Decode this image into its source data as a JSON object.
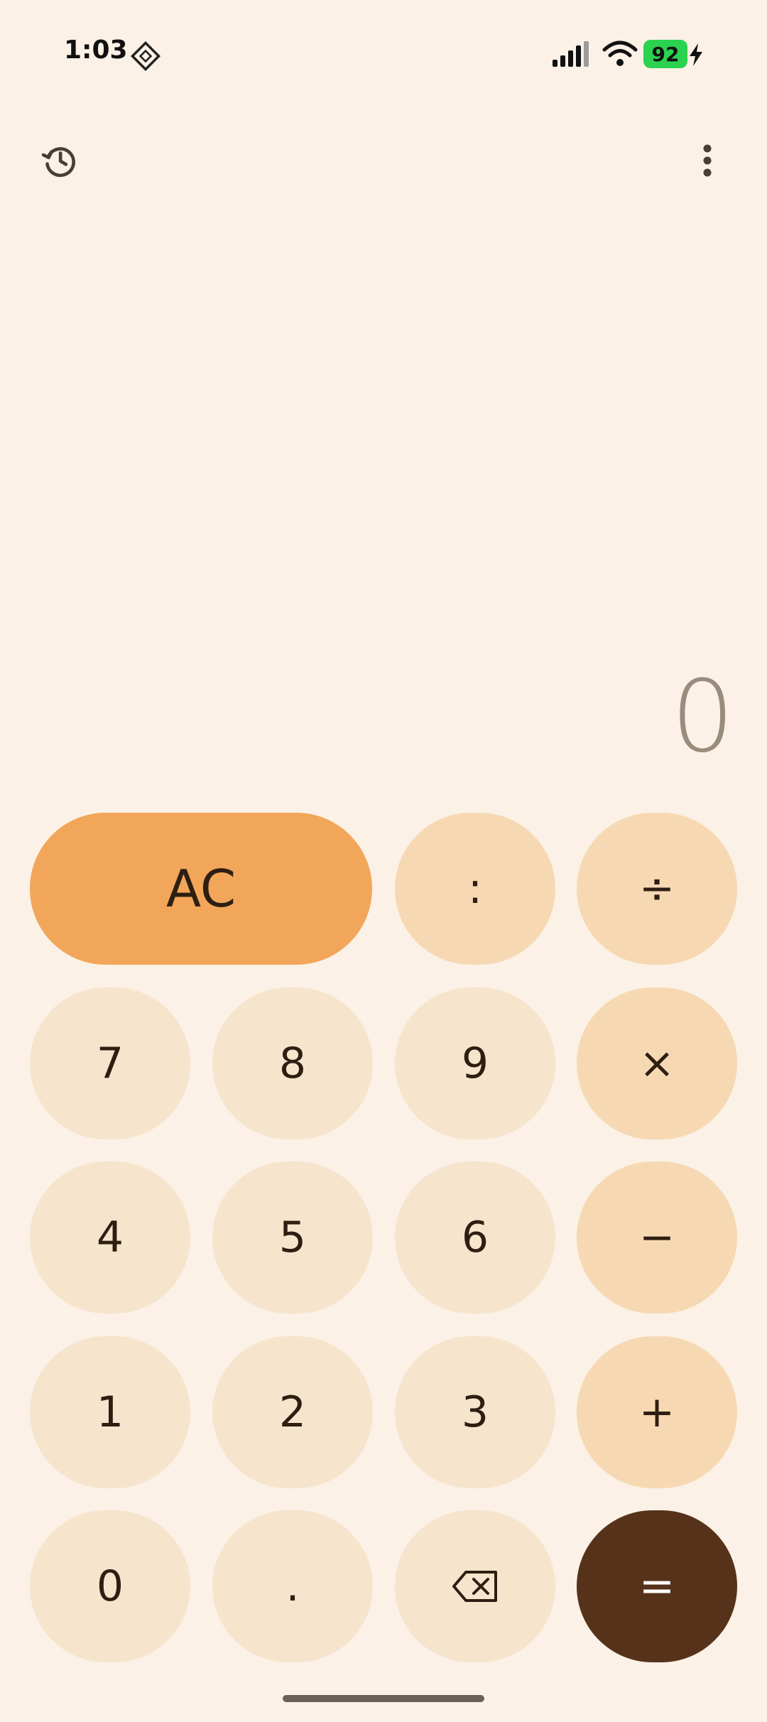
{
  "status_bar": {
    "time": "1:03",
    "battery": "92",
    "icons": [
      "sim-card-icon",
      "signal-icon",
      "wifi-icon",
      "battery-icon",
      "charging-bolt-icon"
    ],
    "battery_color": "#2BD24F"
  },
  "toolbar": {
    "history_icon": "history-icon",
    "more_icon": "more-vert-icon"
  },
  "display": {
    "value": "0"
  },
  "keypad": {
    "clear": "AC",
    "colon": ":",
    "divide": "÷",
    "seven": "7",
    "eight": "8",
    "nine": "9",
    "multiply": "×",
    "four": "4",
    "five": "5",
    "six": "6",
    "minus": "−",
    "one": "1",
    "two": "2",
    "three": "3",
    "plus": "+",
    "zero": "0",
    "decimal": ".",
    "backspace_icon": "backspace-icon",
    "equals": "="
  },
  "colors": {
    "background": "#FBF1E6",
    "digit_key": "#F6E4CD",
    "operator_key": "#F6D9B3",
    "clear_key": "#F2A65A",
    "equals_key": "#57321A",
    "display_text": "#9A8C7C"
  }
}
